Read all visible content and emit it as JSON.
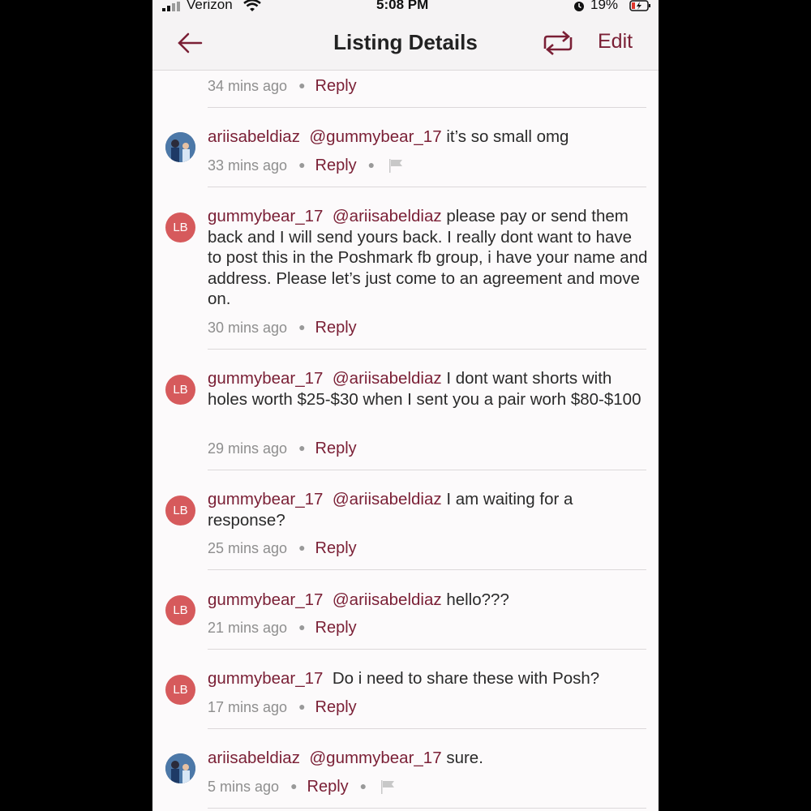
{
  "status_bar": {
    "carrier": "Verizon",
    "time": "5:08 PM",
    "battery": "19%"
  },
  "nav": {
    "title": "Listing Details",
    "edit_label": "Edit"
  },
  "colors": {
    "accent": "#7a1f35",
    "avatar_lb": "#d65a5c"
  },
  "comments": [
    {
      "time": "34 mins ago",
      "reply": "Reply"
    },
    {
      "avatar_initials": "",
      "user": "ariisabeldiaz",
      "mention": "@gummybear_17",
      "text": "it’s so small omg",
      "time": "33 mins ago",
      "reply": "Reply"
    },
    {
      "avatar_initials": "LB",
      "user": "gummybear_17",
      "mention": "@ariisabeldiaz",
      "text": "please pay or send them back and I will send yours back. I really dont want to have to post this in the Poshmark fb group, i have your name and address. Please let’s just come to an agreement and move on.",
      "time": "30 mins ago",
      "reply": "Reply"
    },
    {
      "avatar_initials": "LB",
      "user": "gummybear_17",
      "mention": "@ariisabeldiaz",
      "text": "I dont want shorts with holes worth $25-$30 when I sent you a pair worh $80-$100",
      "time": "29 mins ago",
      "reply": "Reply"
    },
    {
      "avatar_initials": "LB",
      "user": "gummybear_17",
      "mention": "@ariisabeldiaz",
      "text": "I am waiting for a response?",
      "time": "25 mins ago",
      "reply": "Reply"
    },
    {
      "avatar_initials": "LB",
      "user": "gummybear_17",
      "mention": "@ariisabeldiaz",
      "text": "hello???",
      "time": "21 mins ago",
      "reply": "Reply"
    },
    {
      "avatar_initials": "LB",
      "user": "gummybear_17",
      "mention": "",
      "text": "Do i need to share these with Posh?",
      "time": "17 mins ago",
      "reply": "Reply"
    },
    {
      "avatar_initials": "",
      "user": "ariisabeldiaz",
      "mention": "@gummybear_17",
      "text": "sure.",
      "time": "5 mins ago",
      "reply": "Reply"
    }
  ]
}
